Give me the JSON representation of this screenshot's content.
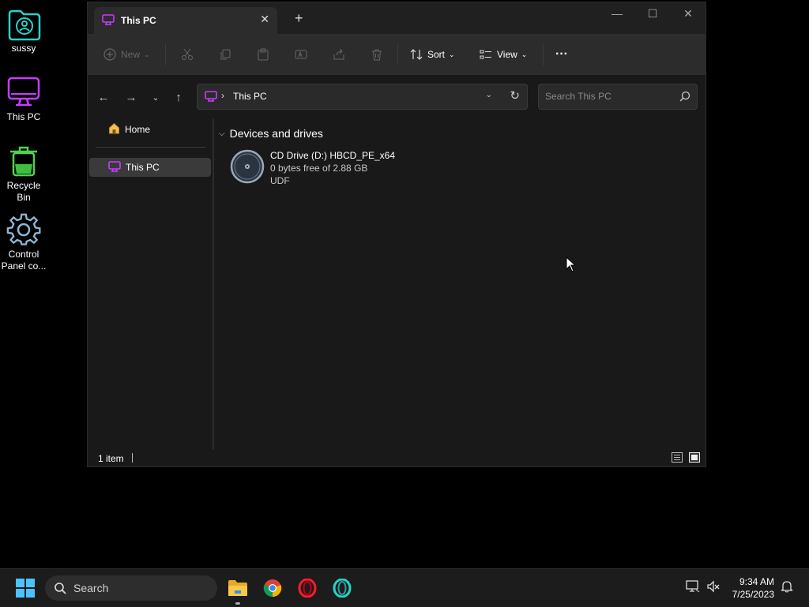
{
  "desktop": {
    "icons": [
      {
        "label": "sussy"
      },
      {
        "label": "This PC"
      },
      {
        "label": "Recycle Bin"
      },
      {
        "label": "Control Panel co..."
      }
    ]
  },
  "window": {
    "tab_title": "This PC",
    "tab_close": "✕",
    "new_tab": "+",
    "controls": {
      "minimize": "—",
      "maximize": "☐",
      "close": "✕"
    },
    "toolbar": {
      "new_label": "New",
      "sort_label": "Sort",
      "view_label": "View",
      "more_label": "···"
    },
    "address": {
      "separator": "›",
      "location": "This PC"
    },
    "search": {
      "placeholder": "Search This PC"
    },
    "sidebar": {
      "home": "Home",
      "this_pc": "This PC"
    },
    "content": {
      "group_title": "Devices and drives",
      "drive": {
        "name": "CD Drive (D:) HBCD_PE_x64",
        "space": "0 bytes free of 2.88 GB",
        "fs": "UDF"
      }
    },
    "status": {
      "count": "1 item"
    }
  },
  "taskbar": {
    "search_label": "Search",
    "time": "9:34 AM",
    "date": "7/25/2023"
  },
  "colors": {
    "accent_purple": "#c83cff",
    "accent_teal": "#28d2c8",
    "folder_yellow": "#f5c04a"
  }
}
